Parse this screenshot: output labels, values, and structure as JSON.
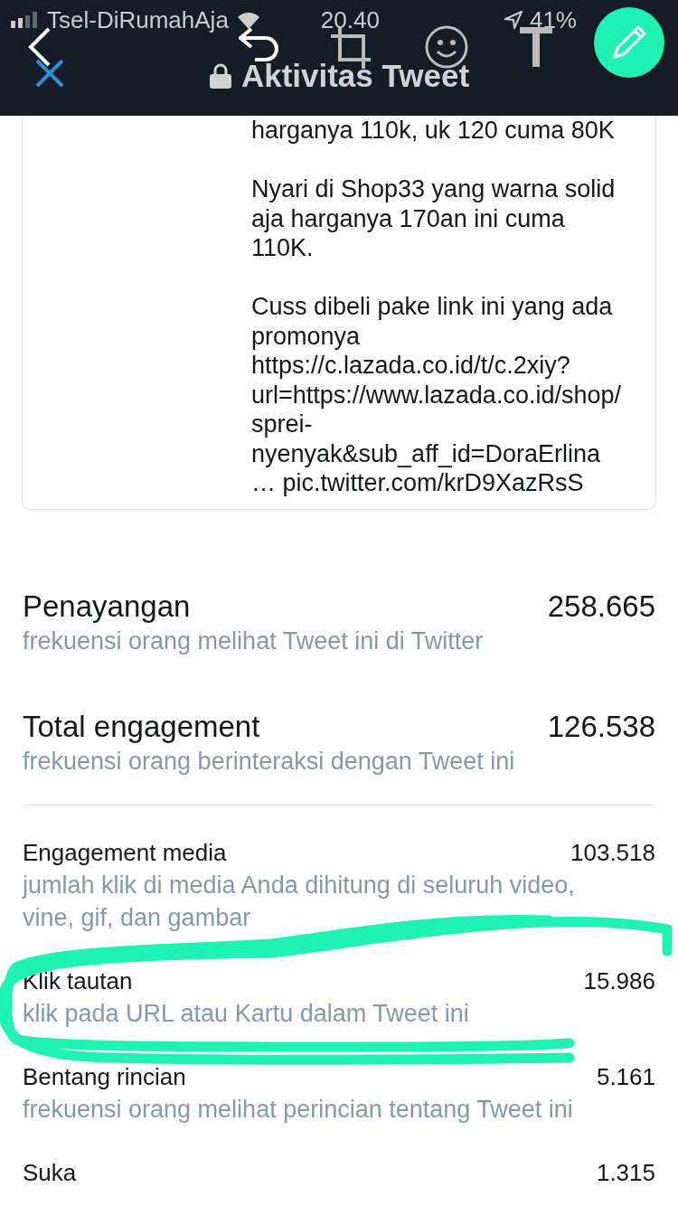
{
  "status_bar": {
    "carrier": "Tsel-DiRumahAja",
    "time": "20.40",
    "battery": "41%"
  },
  "header": {
    "title": "Aktivitas Tweet"
  },
  "tweet": {
    "paragraphs": [
      [
        "harganya 110k, uk 120 cuma 80K"
      ],
      [
        "Nyari di Shop33 yang warna solid aja harganya 170an ini cuma 110K."
      ],
      [
        "Cuss dibeli pake link ini yang ada promonya",
        "https://c.lazada.co.id/t/c.2xiy?url=https://www.lazada.co.id/shop/sprei-nyenyak&sub_aff_id=DoraErlina",
        "… pic.twitter.com/krD9XazRsS"
      ]
    ]
  },
  "primary_metrics": [
    {
      "label": "Penayangan",
      "description": "frekuensi orang melihat Tweet ini di Twitter",
      "value": "258.665"
    },
    {
      "label": "Total engagement",
      "description": "frekuensi orang berinteraksi dengan Tweet ini",
      "value": "126.538"
    }
  ],
  "secondary_metrics": [
    {
      "label": "Engagement media",
      "description": "jumlah klik di media Anda dihitung di seluruh video, vine, gif, dan gambar",
      "value": "103.518"
    },
    {
      "label": "Klik tautan",
      "description": "klik pada URL atau Kartu dalam Tweet ini",
      "value": "15.986"
    },
    {
      "label": "Bentang rincian",
      "description": "frekuensi orang melihat perincian tentang Tweet ini",
      "value": "5.161"
    },
    {
      "label": "Suka",
      "value": "1.315"
    }
  ]
}
